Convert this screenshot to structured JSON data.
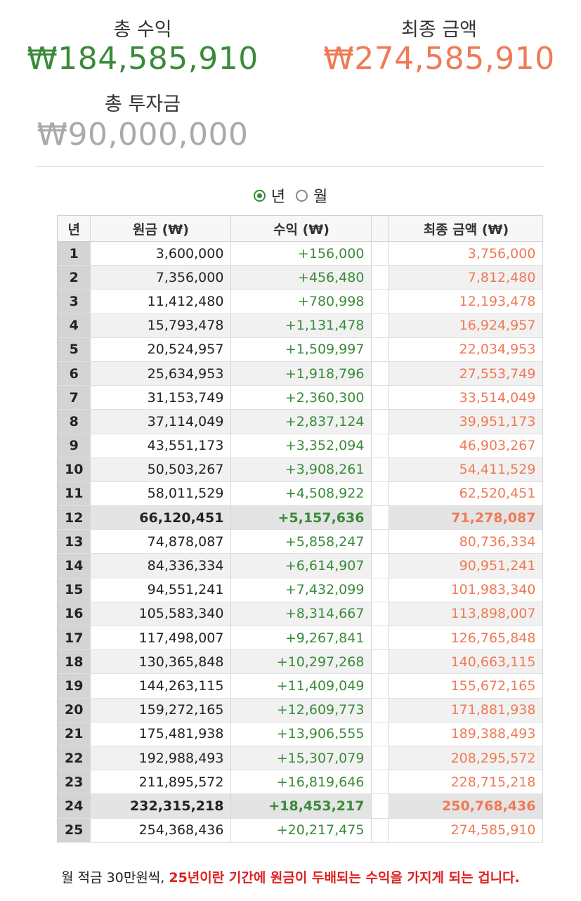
{
  "summary": {
    "total_profit_label": "총 수익",
    "total_profit_value": "₩184,585,910",
    "final_amount_label": "최종 금액",
    "final_amount_value": "₩274,585,910",
    "total_invest_label": "총 투자금",
    "total_invest_value": "₩90,000,000"
  },
  "period_toggle": {
    "options": [
      {
        "label": "년",
        "checked": true
      },
      {
        "label": "월",
        "checked": false
      }
    ]
  },
  "table": {
    "headers": {
      "year": "년",
      "principal": "원금 (₩)",
      "profit": "수익 (₩)",
      "final": "최종 금액 (₩)"
    },
    "rows": [
      {
        "year": "1",
        "principal": "3,600,000",
        "profit": "+156,000",
        "final": "3,756,000"
      },
      {
        "year": "2",
        "principal": "7,356,000",
        "profit": "+456,480",
        "final": "7,812,480"
      },
      {
        "year": "3",
        "principal": "11,412,480",
        "profit": "+780,998",
        "final": "12,193,478"
      },
      {
        "year": "4",
        "principal": "15,793,478",
        "profit": "+1,131,478",
        "final": "16,924,957"
      },
      {
        "year": "5",
        "principal": "20,524,957",
        "profit": "+1,509,997",
        "final": "22,034,953"
      },
      {
        "year": "6",
        "principal": "25,634,953",
        "profit": "+1,918,796",
        "final": "27,553,749"
      },
      {
        "year": "7",
        "principal": "31,153,749",
        "profit": "+2,360,300",
        "final": "33,514,049"
      },
      {
        "year": "8",
        "principal": "37,114,049",
        "profit": "+2,837,124",
        "final": "39,951,173"
      },
      {
        "year": "9",
        "principal": "43,551,173",
        "profit": "+3,352,094",
        "final": "46,903,267"
      },
      {
        "year": "10",
        "principal": "50,503,267",
        "profit": "+3,908,261",
        "final": "54,411,529"
      },
      {
        "year": "11",
        "principal": "58,011,529",
        "profit": "+4,508,922",
        "final": "62,520,451"
      },
      {
        "year": "12",
        "principal": "66,120,451",
        "profit": "+5,157,636",
        "final": "71,278,087",
        "highlight": true
      },
      {
        "year": "13",
        "principal": "74,878,087",
        "profit": "+5,858,247",
        "final": "80,736,334"
      },
      {
        "year": "14",
        "principal": "84,336,334",
        "profit": "+6,614,907",
        "final": "90,951,241"
      },
      {
        "year": "15",
        "principal": "94,551,241",
        "profit": "+7,432,099",
        "final": "101,983,340"
      },
      {
        "year": "16",
        "principal": "105,583,340",
        "profit": "+8,314,667",
        "final": "113,898,007"
      },
      {
        "year": "17",
        "principal": "117,498,007",
        "profit": "+9,267,841",
        "final": "126,765,848"
      },
      {
        "year": "18",
        "principal": "130,365,848",
        "profit": "+10,297,268",
        "final": "140,663,115"
      },
      {
        "year": "19",
        "principal": "144,263,115",
        "profit": "+11,409,049",
        "final": "155,672,165"
      },
      {
        "year": "20",
        "principal": "159,272,165",
        "profit": "+12,609,773",
        "final": "171,881,938"
      },
      {
        "year": "21",
        "principal": "175,481,938",
        "profit": "+13,906,555",
        "final": "189,388,493"
      },
      {
        "year": "22",
        "principal": "192,988,493",
        "profit": "+15,307,079",
        "final": "208,295,572"
      },
      {
        "year": "23",
        "principal": "211,895,572",
        "profit": "+16,819,646",
        "final": "228,715,218"
      },
      {
        "year": "24",
        "principal": "232,315,218",
        "profit": "+18,453,217",
        "final": "250,768,436",
        "highlight": true
      },
      {
        "year": "25",
        "principal": "254,368,436",
        "profit": "+20,217,475",
        "final": "274,585,910"
      }
    ]
  },
  "footnote": {
    "plain": "월 적금 30만원씩, ",
    "emphasis": "25년이란 기간에 원금이 두배되는 수익을 가지게 되는 겁니다."
  },
  "colors": {
    "profit_green": "#3a8a3a",
    "final_orange": "#ef7a55",
    "invest_gray": "#aaaaaa",
    "emphasis_red": "#e02020"
  }
}
